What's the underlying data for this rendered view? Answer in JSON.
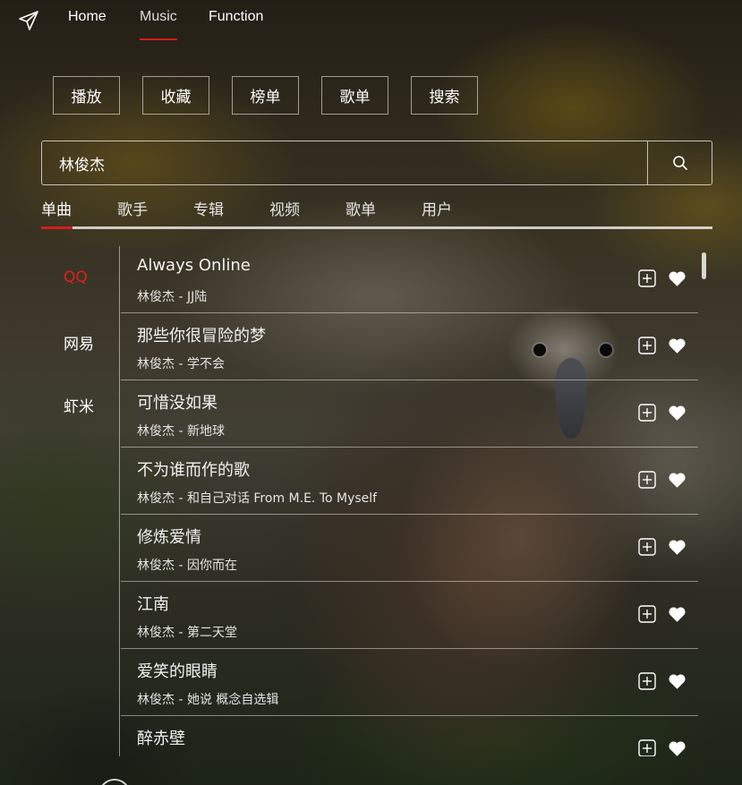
{
  "nav": {
    "items": [
      {
        "label": "Home"
      },
      {
        "label": "Music"
      },
      {
        "label": "Function"
      }
    ],
    "active": "Music"
  },
  "actions": [
    "播放",
    "收藏",
    "榜单",
    "歌单",
    "搜索"
  ],
  "search": {
    "value": "林俊杰",
    "icon": "search-icon"
  },
  "tabs": [
    "单曲",
    "歌手",
    "专辑",
    "视频",
    "歌单",
    "用户"
  ],
  "active_tab": "单曲",
  "sources": [
    "QQ",
    "网易",
    "虾米"
  ],
  "active_source": "QQ",
  "songs": [
    {
      "title": "Always Online",
      "sub": "林俊杰 - JJ陆"
    },
    {
      "title": "那些你很冒险的梦",
      "sub": "林俊杰 - 学不会"
    },
    {
      "title": "可惜没如果",
      "sub": "林俊杰 - 新地球"
    },
    {
      "title": "不为谁而作的歌",
      "sub": "林俊杰 - 和自己对话 From M.E. To Myself"
    },
    {
      "title": "修炼爱情",
      "sub": "林俊杰 - 因你而在"
    },
    {
      "title": "江南",
      "sub": "林俊杰 - 第二天堂"
    },
    {
      "title": "爱笑的眼睛",
      "sub": "林俊杰 - 她说 概念自选辑"
    },
    {
      "title": "醉赤壁",
      "sub": ""
    }
  ],
  "colors": {
    "accent": "#d31d1d",
    "active_source": "#e0201d"
  }
}
